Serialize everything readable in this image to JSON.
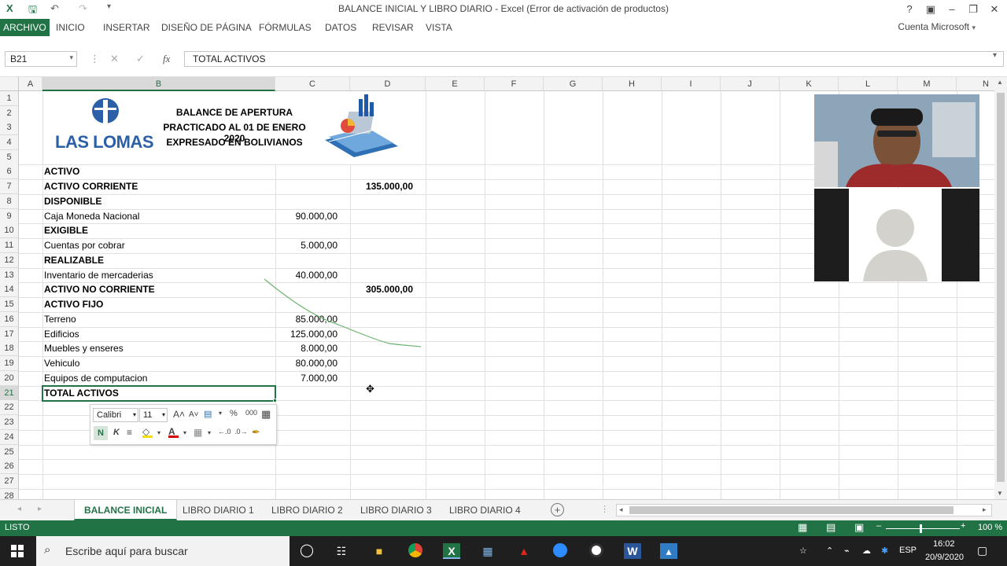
{
  "window": {
    "title": "BALANCE INICIAL Y LIBRO DIARIO - Excel (Error de activación de productos)",
    "account": "Cuenta Microsoft",
    "help": "?"
  },
  "ribbon": {
    "tabs": [
      "ARCHIVO",
      "INICIO",
      "INSERTAR",
      "DISEÑO DE PÁGINA",
      "FÓRMULAS",
      "DATOS",
      "REVISAR",
      "VISTA"
    ]
  },
  "formula_bar": {
    "name_box": "B21",
    "fx_label": "fx",
    "content": "TOTAL ACTIVOS"
  },
  "columns": [
    "A",
    "B",
    "C",
    "D",
    "E",
    "F",
    "G",
    "H",
    "I",
    "J",
    "K",
    "L",
    "M",
    "N"
  ],
  "rows": [
    "1",
    "2",
    "3",
    "4",
    "5",
    "6",
    "7",
    "8",
    "9",
    "10",
    "11",
    "12",
    "13",
    "14",
    "15",
    "16",
    "17",
    "18",
    "19",
    "20",
    "21",
    "22",
    "23",
    "24",
    "25",
    "26",
    "27",
    "28"
  ],
  "header": {
    "logo_text": "LAS LOMAS",
    "line1": "BALANCE DE APERTURA",
    "line2": "PRACTICADO AL 01 DE ENERO 2020",
    "line3": "EXPRESADO EN BOLIVIANOS"
  },
  "cells": {
    "b6": "ACTIVO",
    "b7": "ACTIVO CORRIENTE",
    "d7": "135.000,00",
    "b8": "DISPONIBLE",
    "b9": "Caja Moneda Nacional",
    "c9": "90.000,00",
    "b10": "EXIGIBLE",
    "b11": "Cuentas por cobrar",
    "c11": "5.000,00",
    "b12": "REALIZABLE",
    "b13": "Inventario de mercaderias",
    "c13": "40.000,00",
    "b14": "ACTIVO NO CORRIENTE",
    "d14": "305.000,00",
    "b15": "ACTIVO FIJO",
    "b16": "Terreno",
    "c16": "85.000,00",
    "b17": "Edificios",
    "c17": "125.000,00",
    "b18": "Muebles y enseres",
    "c18": "8.000,00",
    "b19": "Vehiculo",
    "c19": "80.000,00",
    "b20": "Equipos de computacion",
    "c20": "7.000,00",
    "b21": "TOTAL ACTIVOS"
  },
  "mini_toolbar": {
    "font": "Calibri",
    "size": "11",
    "bold": "N",
    "italic": "K",
    "percent": "%",
    "thousands": "000"
  },
  "sheets": [
    "BALANCE INICIAL",
    "LIBRO DIARIO 1",
    "LIBRO DIARIO 2",
    "LIBRO DIARIO 3",
    "LIBRO DIARIO 4"
  ],
  "status": {
    "mode": "LISTO",
    "zoom": "100 %"
  },
  "taskbar": {
    "search_placeholder": "Escribe aquí para buscar",
    "language": "ESP",
    "time": "16:02",
    "date": "20/9/2020"
  },
  "colors": {
    "excel_green": "#217346",
    "taskbar": "#1f1f1f"
  }
}
